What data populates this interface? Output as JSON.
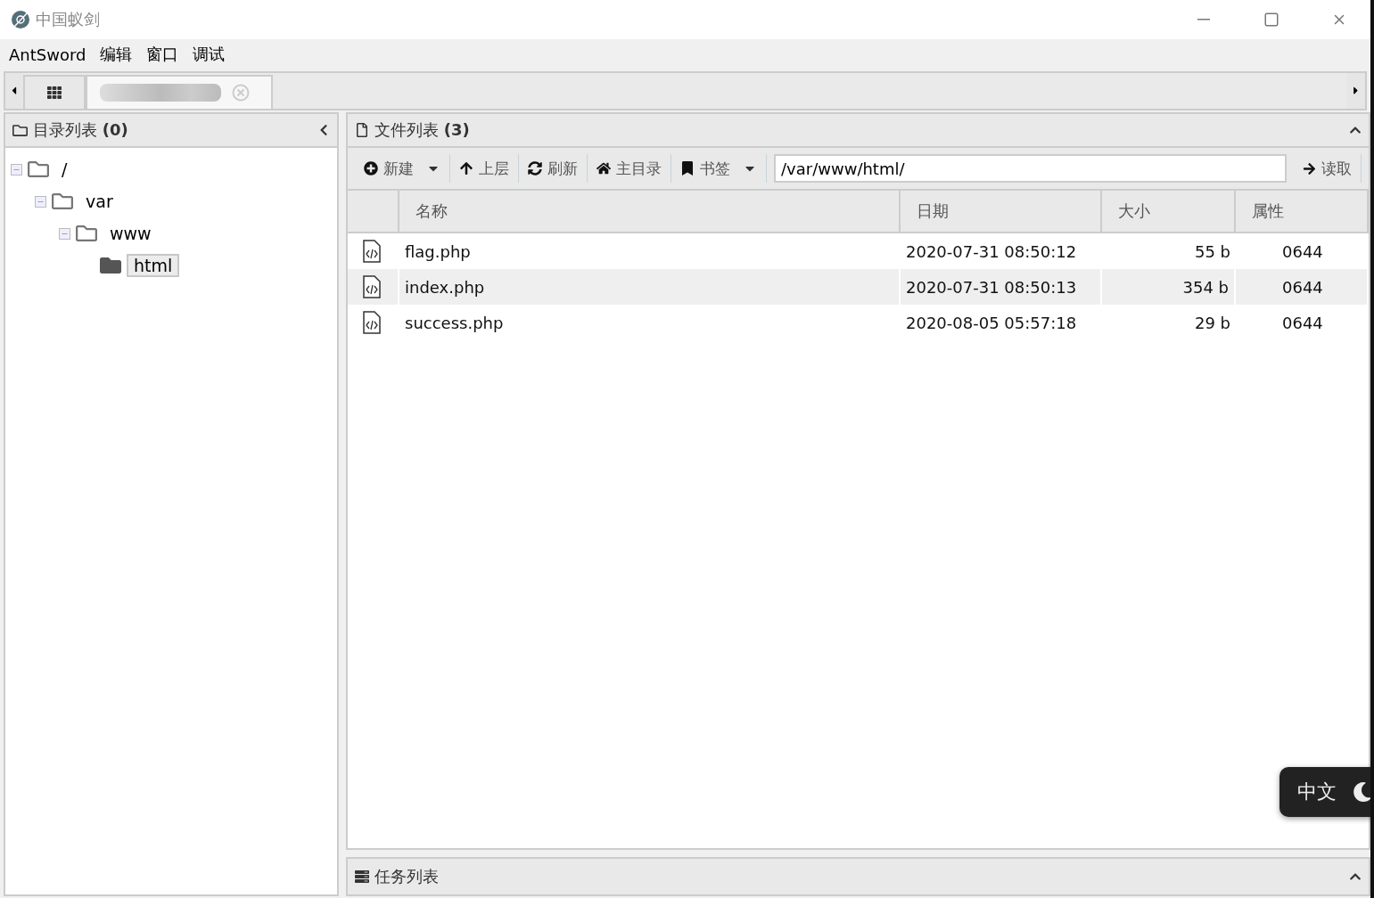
{
  "window": {
    "title": "中国蚁剑"
  },
  "menu": [
    "AntSword",
    "编辑",
    "窗口",
    "调试"
  ],
  "tabs": [
    {
      "kind": "home",
      "selected": false
    },
    {
      "kind": "redacted",
      "selected": true
    }
  ],
  "dir_panel": {
    "title": "目录列表",
    "count": "(0)",
    "tree": [
      {
        "label": "/",
        "expanded": true,
        "selected": false,
        "children": [
          {
            "label": "var",
            "expanded": true,
            "selected": false,
            "children": [
              {
                "label": "www",
                "expanded": true,
                "selected": false,
                "children": [
                  {
                    "label": "html",
                    "selected": true
                  }
                ]
              }
            ]
          }
        ]
      }
    ]
  },
  "file_panel": {
    "title": "文件列表",
    "count": "(3)",
    "toolbar": [
      {
        "kind": "dropdown",
        "label": "新建"
      },
      {
        "kind": "button",
        "label": "上层"
      },
      {
        "kind": "button",
        "label": "刷新"
      },
      {
        "kind": "button",
        "label": "主目录"
      },
      {
        "kind": "dropdown",
        "label": "书签"
      }
    ],
    "path": {
      "value": "/var/www/html/"
    },
    "read_button": "读取",
    "columns": [
      "名称",
      "日期",
      "大小",
      "属性"
    ],
    "rows": [
      {
        "name": "flag.php",
        "date": "2020-07-31 08:50:12",
        "size": "55 b",
        "attr": "0644",
        "selected": false
      },
      {
        "name": "index.php",
        "date": "2020-07-31 08:50:13",
        "size": "354 b",
        "attr": "0644",
        "selected": true
      },
      {
        "name": "success.php",
        "date": "2020-08-05 05:57:18",
        "size": "29 b",
        "attr": "0644",
        "selected": false
      }
    ]
  },
  "task_panel": {
    "title": "任务列表"
  },
  "language_pill": {
    "label": "中文"
  }
}
